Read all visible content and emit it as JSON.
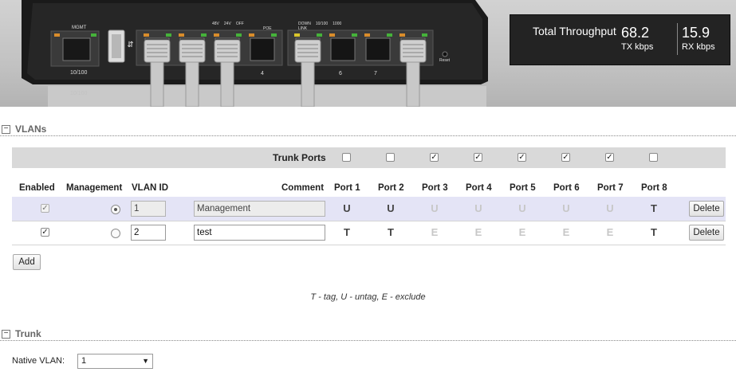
{
  "device": {
    "mgmt_label": "MGMT",
    "mgmt_speed": "10/100",
    "mgmt_speed_2": "10/100",
    "usb_symbol": "⇆",
    "poe_legend": [
      "48V",
      "24V",
      "OFF"
    ],
    "poe_label": "POE",
    "link_label": "LINK",
    "link_legend": [
      "DOWN",
      "10/100",
      "1000"
    ],
    "port_numbers": [
      "4",
      "6",
      "7"
    ],
    "reset_label": "Reset"
  },
  "throughput": {
    "title": "Total Throughput",
    "tx_value": "68.2",
    "tx_unit": "TX kbps",
    "rx_value": "15.9",
    "rx_unit": "RX kbps"
  },
  "vlans": {
    "toggle": "−",
    "title": "VLANs",
    "trunk_ports_label": "Trunk Ports",
    "trunk_ports": [
      false,
      false,
      true,
      true,
      true,
      true,
      true,
      false
    ],
    "columns": {
      "enabled": "Enabled",
      "management": "Management",
      "vlan_id": "VLAN ID",
      "comment": "Comment",
      "ports": [
        "Port 1",
        "Port 2",
        "Port 3",
        "Port 4",
        "Port 5",
        "Port 6",
        "Port 7",
        "Port 8"
      ]
    },
    "rows": [
      {
        "enabled": true,
        "management": true,
        "vlan_id": "1",
        "comment": "Management",
        "ports": [
          "U",
          "U",
          "U",
          "U",
          "U",
          "U",
          "U",
          "T"
        ],
        "ports_disabled": [
          false,
          false,
          true,
          true,
          true,
          true,
          true,
          false
        ],
        "delete_label": "Delete",
        "editable": false
      },
      {
        "enabled": true,
        "management": false,
        "vlan_id": "2",
        "comment": "test",
        "ports": [
          "T",
          "T",
          "E",
          "E",
          "E",
          "E",
          "E",
          "T"
        ],
        "ports_disabled": [
          false,
          false,
          true,
          true,
          true,
          true,
          true,
          false
        ],
        "delete_label": "Delete",
        "editable": true
      }
    ],
    "add_label": "Add",
    "legend": "T - tag, U - untag, E - exclude"
  },
  "trunk": {
    "toggle": "−",
    "title": "Trunk",
    "native_vlan_label": "Native VLAN:",
    "native_vlan_value": "1"
  },
  "colors": {
    "header_bg": "#c4c4c4",
    "device_body": "#1c1c1c",
    "throughput_bg": "#232323",
    "row_highlight": "#e4e4f6",
    "trunk_bar": "#d9d9d9"
  }
}
